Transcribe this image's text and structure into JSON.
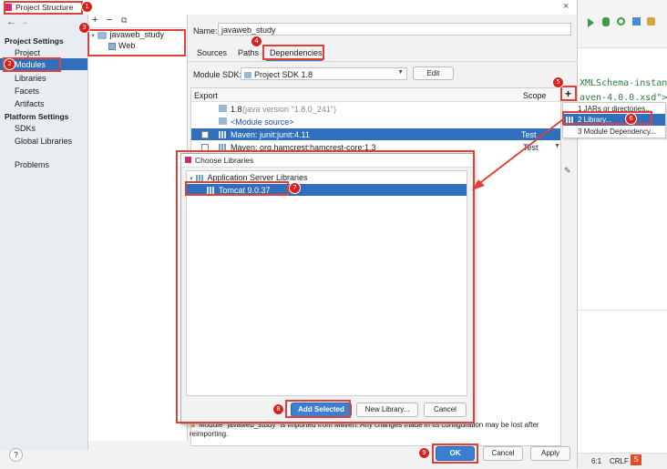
{
  "window": {
    "title": "Project Structure"
  },
  "nav": {
    "back": "←",
    "forward": "→",
    "project_settings_header": "Project Settings",
    "project_settings": [
      "Project",
      "Modules",
      "Libraries",
      "Facets",
      "Artifacts"
    ],
    "platform_settings_header": "Platform Settings",
    "platform_settings": [
      "SDKs",
      "Global Libraries"
    ],
    "problems": "Problems",
    "help": "?"
  },
  "module_tree": {
    "add": "+",
    "remove": "−",
    "copy": "⧉",
    "root": "javaweb_study",
    "child": "Web"
  },
  "module": {
    "name_label": "Name:",
    "name_value": "javaweb_study",
    "tabs": [
      "Sources",
      "Paths",
      "Dependencies"
    ],
    "sdk_label": "Module SDK:",
    "sdk_value": "Project SDK 1.8",
    "edit_button": "Edit",
    "table_headers": {
      "export": "Export",
      "scope": "Scope"
    },
    "dependencies": [
      {
        "name": "1.8",
        "detail": "(java version \"1.8.0_241\")",
        "scope": ""
      },
      {
        "name": "<Module source>",
        "detail": "",
        "scope": ""
      },
      {
        "name": "Maven: junit:junit:4.11",
        "detail": "",
        "scope": "Test"
      },
      {
        "name": "Maven: org.hamcrest:hamcrest-core:1.3",
        "detail": "",
        "scope": "Test"
      }
    ],
    "warning": "Module \"javaweb_study\" is imported from Maven. Any changes made in its configuration may be lost after reimporting."
  },
  "add_menu": {
    "plus": "+",
    "items": [
      "1  JARs or directories...",
      "2  Library...",
      "3  Module Dependency..."
    ]
  },
  "choose_libraries": {
    "title": "Choose Libraries",
    "group": "Application Server Libraries",
    "item": "Tomcat 9.0.37",
    "add_selected": "Add Selected",
    "new_library": "New Library...",
    "cancel": "Cancel"
  },
  "footer": {
    "ok": "OK",
    "cancel": "Cancel",
    "apply": "Apply"
  },
  "background_ide": {
    "code_line1": "XMLSchema-instan",
    "code_line2": "aven-4.0.0.xsd\">",
    "status_pos": "6:1",
    "status_crlf": "CRLF"
  },
  "badges": [
    "1",
    "2",
    "3",
    "4",
    "5",
    "6",
    "7",
    "8",
    "9"
  ],
  "colors": {
    "accent": "#3a7fd1",
    "selection": "#2f6fbd",
    "annotation": "#e0403a"
  }
}
